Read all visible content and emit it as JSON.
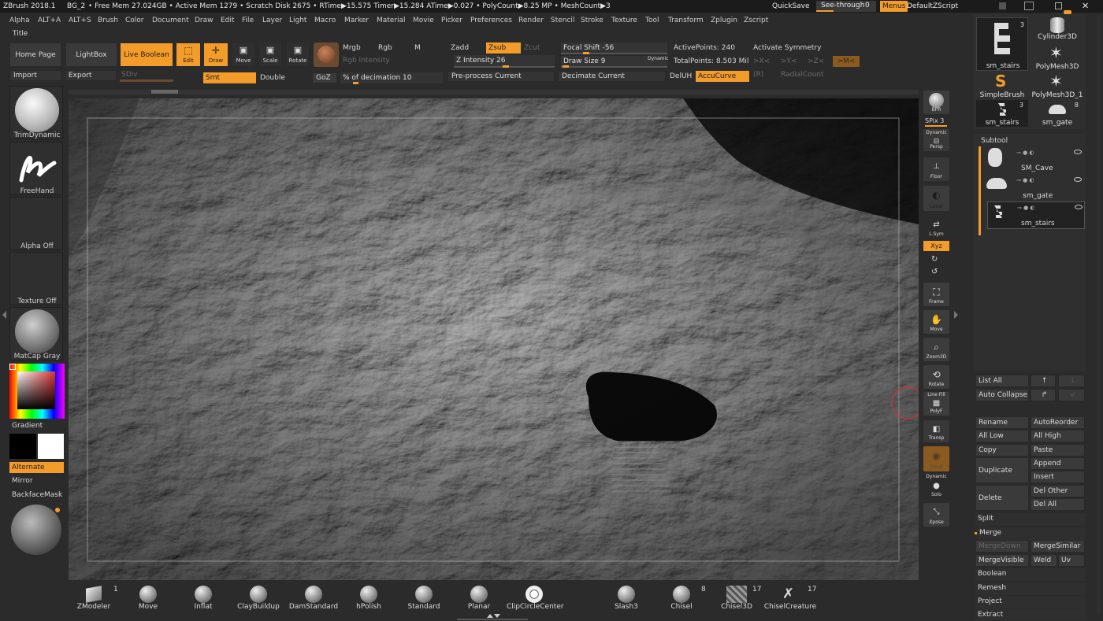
{
  "topbar": {
    "app": "ZBrush 2018.1",
    "doc": "BG_2",
    "stats": "• Free Mem 27.024GB • Active Mem 1279 • Scratch Disk 2675 • RTime▶15.575 Timer▶15.284 ATime▶0.027 • PolyCount▶8.25 MP • MeshCount▶3",
    "quicksave": "QuickSave",
    "seethrough": "See-through",
    "seethrough_val": "0",
    "menus": "Menus",
    "defaultzscript": "DefaultZScript"
  },
  "menus": [
    "Alpha",
    "ALT+A",
    "ALT+S",
    "Brush",
    "Color",
    "Document",
    "Draw",
    "Edit",
    "File",
    "Layer",
    "Light",
    "Macro",
    "Marker",
    "Material",
    "Movie",
    "Picker",
    "Preferences",
    "Render",
    "Stencil",
    "Stroke",
    "Texture",
    "Tool",
    "Transform",
    "Zplugin",
    "Zscript"
  ],
  "title": "Title",
  "toolbar": {
    "home": "Home Page",
    "lightbox": "LightBox",
    "liveboolean": "Live Boolean",
    "edit": "Edit",
    "draw": "Draw",
    "move": "Move",
    "scale": "Scale",
    "rotate": "Rotate",
    "import": "Import",
    "export": "Export",
    "sdiv": "SDiv",
    "mrgb": "Mrgb",
    "rgb": "Rgb",
    "m": "M",
    "rgbintensity": "Rgb Intensity",
    "zadd": "Zadd",
    "zsub": "Zsub",
    "zcut": "Zcut",
    "zintensity": "Z Intensity 26",
    "focalshift": "Focal Shift -56",
    "drawsize": "Draw Size 9",
    "dynamic": "Dynamic",
    "activepoints": "ActivePoints: 240",
    "totalpoints": "TotalPoints: 8.503 Mil",
    "activatesymmetry": "Activate Symmetry",
    "symx": ">X<",
    "symy": ">Y<",
    "symz": ">Z<",
    "symm": ">M<",
    "radialcount": "RadialCount",
    "r": "(R)",
    "smt": "Smt",
    "double": "Double",
    "goz": "GoZ",
    "decimation": "% of decimation 10",
    "preprocess": "Pre-process Current",
    "decimate": "Decimate Current",
    "deluh": "DelUH",
    "accucurve": "AccuCurve"
  },
  "left": {
    "brush": "TrimDynamic",
    "stroke": "FreeHand",
    "alpha": "Alpha Off",
    "texture": "Texture Off",
    "material": "MatCap Gray",
    "gradient": "Gradient",
    "alternate": "Alternate",
    "mirror": "Mirror",
    "backface": "BackfaceMask"
  },
  "right_tools": [
    {
      "label": "BPR"
    },
    {
      "label": "SPix 3"
    },
    {
      "label": "Persp",
      "sub": "Dynamic"
    },
    {
      "label": "Floor"
    },
    {
      "label": "Local"
    },
    {
      "label": "L.Sym"
    },
    {
      "label": "Xyz"
    },
    {
      "label": "Frame"
    },
    {
      "label": "Move"
    },
    {
      "label": "Zoom3D"
    },
    {
      "label": "Rotate"
    },
    {
      "label": "PolyF",
      "sub": "Line Fill"
    },
    {
      "label": "Transp"
    },
    {
      "label": "Ghost"
    },
    {
      "label": "Solo",
      "sub": "Dynamic"
    },
    {
      "label": "Xpose"
    }
  ],
  "tools": [
    {
      "label": "sm_stairs",
      "num": "3"
    },
    {
      "label": "Cylinder3D"
    },
    {
      "label": "PolyMesh3D"
    },
    {
      "label": "SimpleBrush"
    },
    {
      "label": "PolyMesh3D_1"
    },
    {
      "label": "sm_stairs",
      "num": "3"
    },
    {
      "label": "sm_gate",
      "num": "8"
    }
  ],
  "subtool": {
    "title": "Subtool",
    "items": [
      "SM_Cave",
      "sm_gate",
      "sm_stairs"
    ]
  },
  "subtool_btns": {
    "listall": "List All",
    "autocollapse": "Auto Collapse",
    "rename": "Rename",
    "autoreorder": "AutoReorder",
    "alllow": "All Low",
    "allhigh": "All High",
    "copy": "Copy",
    "paste": "Paste",
    "duplicate": "Duplicate",
    "append": "Append",
    "insert": "Insert",
    "delete": "Delete",
    "delother": "Del Other",
    "delall": "Del All",
    "split": "Split",
    "merge": "Merge",
    "mergedown": "MergeDown",
    "mergesimilar": "MergeSimilar",
    "mergevisible": "MergeVisible",
    "weld": "Weld",
    "uv": "Uv",
    "boolean": "Boolean",
    "remesh": "Remesh",
    "project": "Project",
    "extract": "Extract"
  },
  "brushes": [
    {
      "label": "ZModeler",
      "num": "1"
    },
    {
      "label": "Move"
    },
    {
      "label": "Inflat"
    },
    {
      "label": "ClayBuildup"
    },
    {
      "label": "DamStandard"
    },
    {
      "label": "hPolish"
    },
    {
      "label": "Standard"
    },
    {
      "label": "Planar"
    },
    {
      "label": "ClipCircleCenter"
    },
    {
      "label": "Slash3"
    },
    {
      "label": "Chisel",
      "num": "8"
    },
    {
      "label": "Chisel3D",
      "num": "17"
    },
    {
      "label": "ChiselCreature",
      "num": "17"
    }
  ]
}
